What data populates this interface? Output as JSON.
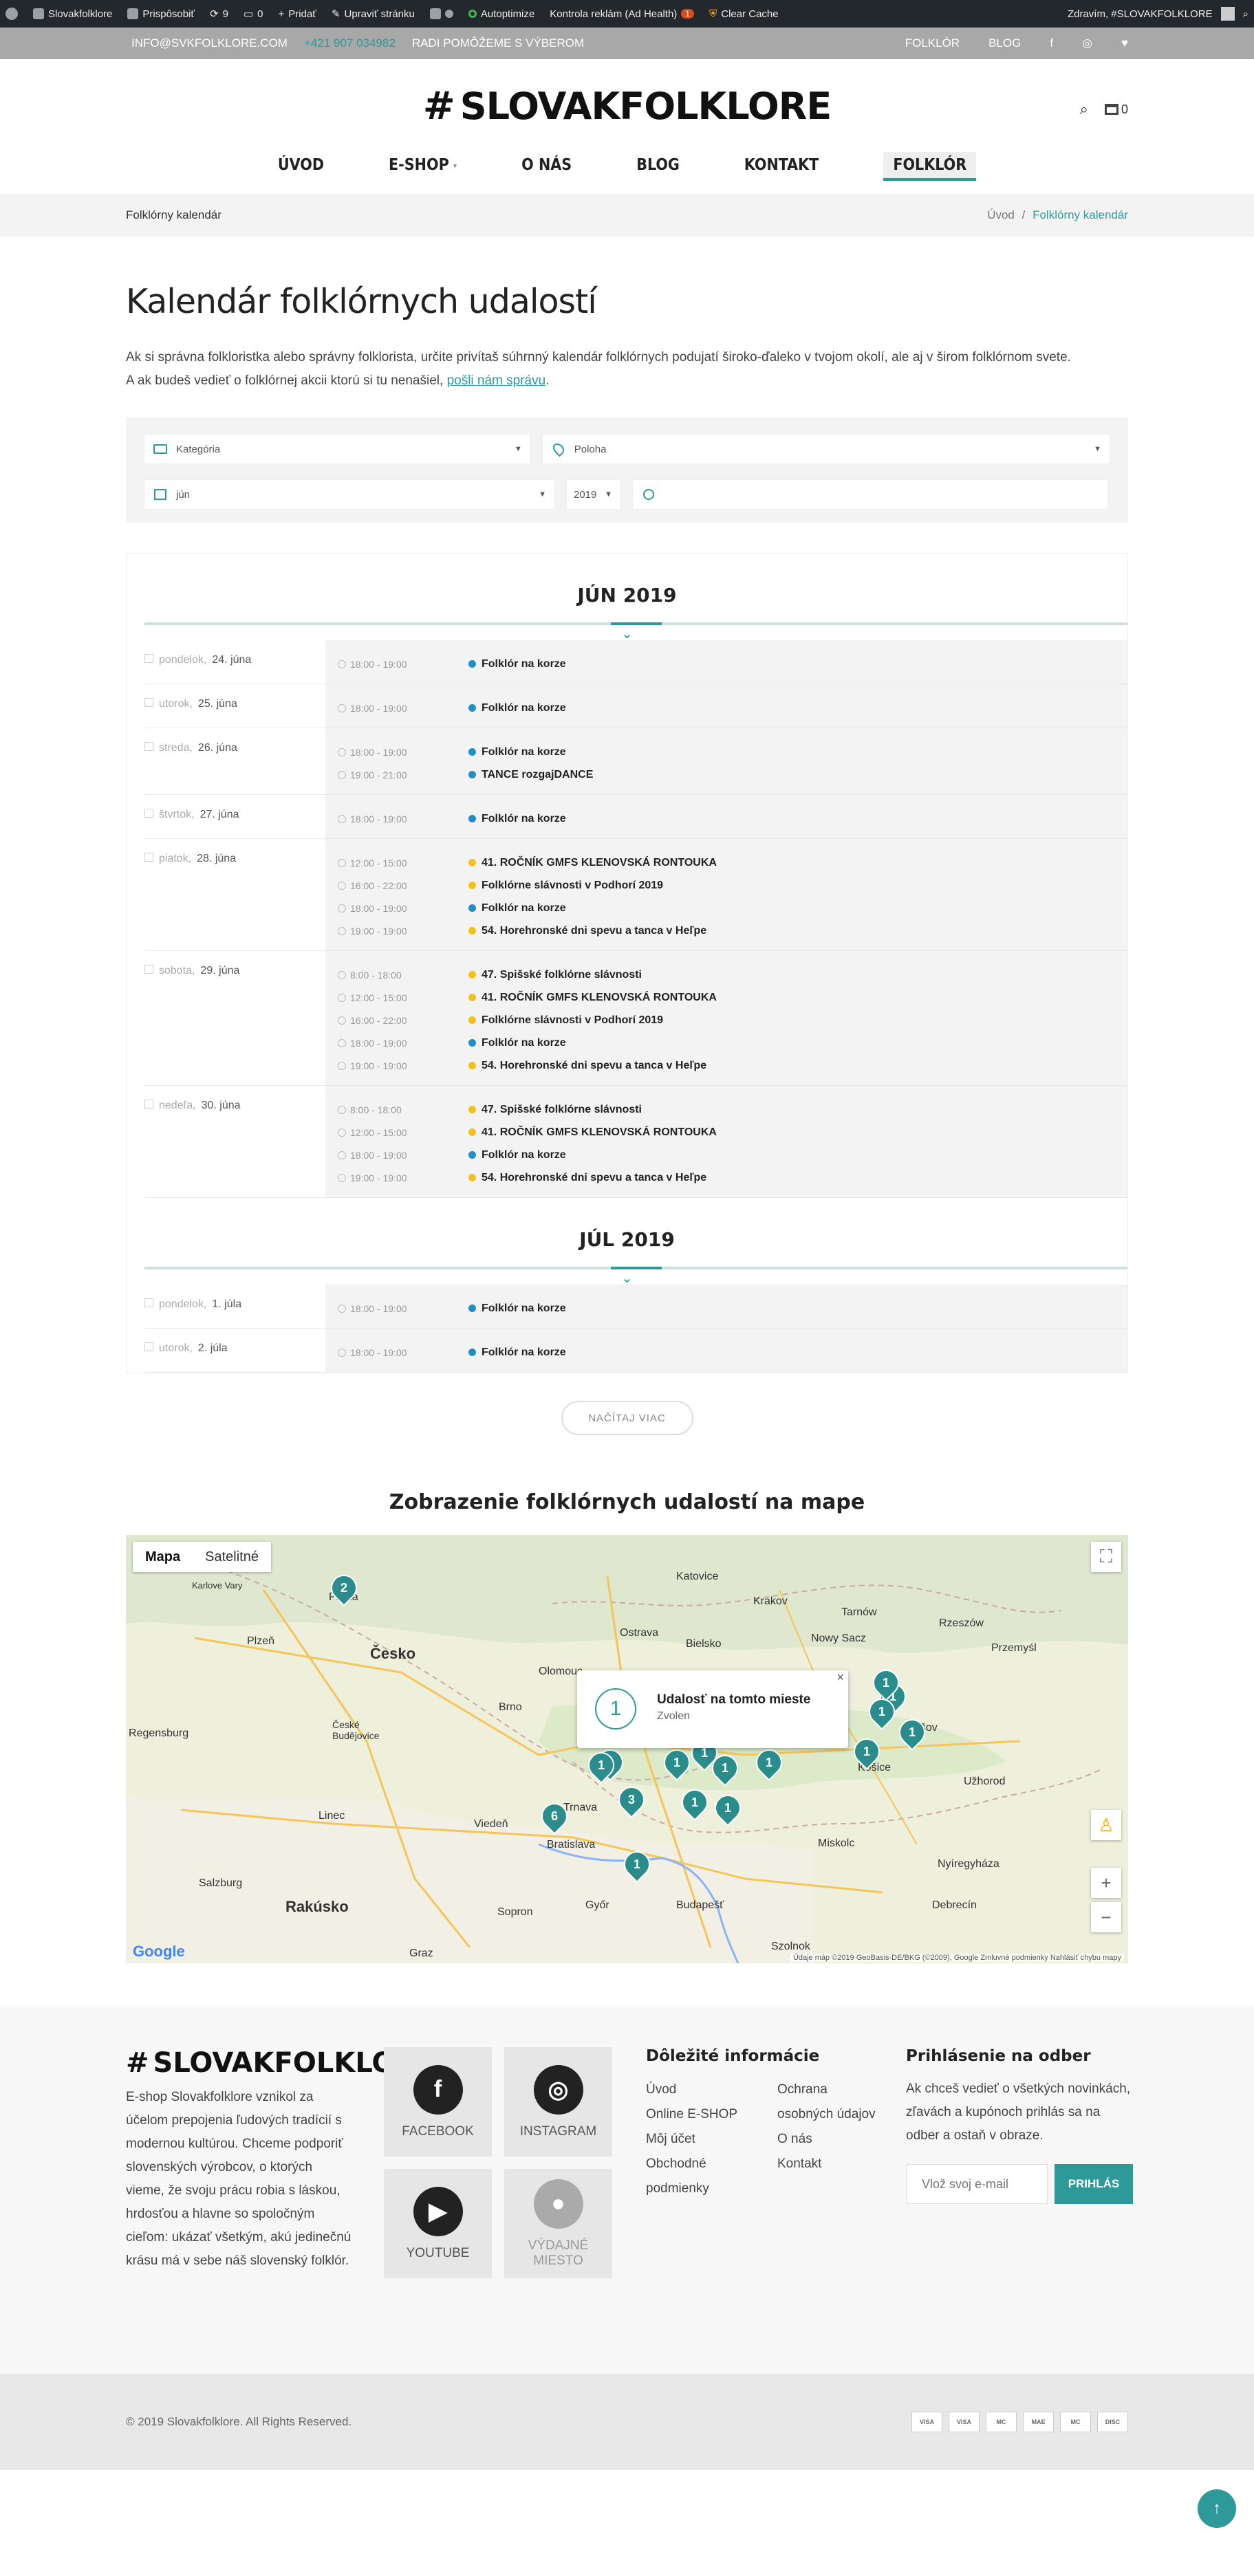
{
  "adminbar": {
    "site": "Slovakfolklore",
    "customize": "Prispôsobiť",
    "updates": "9",
    "comments": "0",
    "add": "Pridať",
    "edit": "Upraviť stránku",
    "autoptimize": "Autoptimize",
    "adhealth": "Kontrola reklám (Ad Health)",
    "adhealth_count": "1",
    "cache": "Clear Cache",
    "greeting": "Zdravím, #SLOVAKFOLKLORE"
  },
  "topbar": {
    "email": "INFO@SVKFOLKLORE.COM",
    "phone": "+421 907 034982",
    "tagline": "RADI POMÔŽEME S VÝBEROM",
    "links": [
      "FOLKLÓR",
      "BLOG"
    ]
  },
  "header": {
    "logo": "SLOVAKFOLKLORE",
    "cart_count": "0"
  },
  "nav": [
    "ÚVOD",
    "E-SHOP",
    "O NÁS",
    "BLOG",
    "KONTAKT",
    "FOLKLÓR"
  ],
  "breadcrumb": {
    "title": "Folklórny kalendár",
    "home": "Úvod",
    "sep": "/",
    "current": "Folklórny kalendár"
  },
  "page": {
    "title": "Kalendár folklórnych udalostí",
    "intro_1": "Ak si správna folkloristka alebo správny folklorista, určite privítaš súhrnný kalendár folklórnych podujatí široko-ďaleko v tvojom okolí, ale aj v širom folklórnom svete.",
    "intro_2": "A ak budeš vedieť o folklórnej akcii ktorú si tu nenašiel,",
    "intro_link": "pošli nám správu",
    "intro_end": "."
  },
  "filters": {
    "category": "Kategória",
    "location": "Poloha",
    "month": "jún",
    "year": "2019",
    "search_placeholder": ""
  },
  "colors": {
    "accent": "#2d9a99",
    "blue": "#1f8fc9",
    "yellow": "#f2c21b"
  },
  "calendar": {
    "months": [
      {
        "title": "JÚN 2019",
        "days": [
          {
            "weekday": "pondelok,",
            "date": "24. júna",
            "events": [
              {
                "time": "18:00 - 19:00",
                "name": "Folklór na korze",
                "color": "blue"
              }
            ]
          },
          {
            "weekday": "utorok,",
            "date": "25. júna",
            "events": [
              {
                "time": "18:00 - 19:00",
                "name": "Folklór na korze",
                "color": "blue"
              }
            ]
          },
          {
            "weekday": "streda,",
            "date": "26. júna",
            "events": [
              {
                "time": "18:00 - 19:00",
                "name": "Folklór na korze",
                "color": "blue"
              },
              {
                "time": "19:00 - 21:00",
                "name": "TANCE rozgajDANCE",
                "color": "blue"
              }
            ]
          },
          {
            "weekday": "štvrtok,",
            "date": "27. júna",
            "events": [
              {
                "time": "18:00 - 19:00",
                "name": "Folklór na korze",
                "color": "blue"
              }
            ]
          },
          {
            "weekday": "piatok,",
            "date": "28. júna",
            "events": [
              {
                "time": "12:00 - 15:00",
                "name": "41. ROČNÍK GMFS KLENOVSKÁ RONTOUKA",
                "color": "yellow"
              },
              {
                "time": "16:00 - 22:00",
                "name": "Folklórne slávnosti v Podhorí 2019",
                "color": "yellow"
              },
              {
                "time": "18:00 - 19:00",
                "name": "Folklór na korze",
                "color": "blue"
              },
              {
                "time": "19:00 - 19:00",
                "name": "54. Horehronské dni spevu a tanca v Heľpe",
                "color": "yellow"
              }
            ]
          },
          {
            "weekday": "sobota,",
            "date": "29. júna",
            "events": [
              {
                "time": "8:00 - 18:00",
                "name": "47. Spišské folklórne slávnosti",
                "color": "yellow"
              },
              {
                "time": "12:00 - 15:00",
                "name": "41. ROČNÍK GMFS KLENOVSKÁ RONTOUKA",
                "color": "yellow"
              },
              {
                "time": "16:00 - 22:00",
                "name": "Folklórne slávnosti v Podhorí 2019",
                "color": "yellow"
              },
              {
                "time": "18:00 - 19:00",
                "name": "Folklór na korze",
                "color": "blue"
              },
              {
                "time": "19:00 - 19:00",
                "name": "54. Horehronské dni spevu a tanca v Heľpe",
                "color": "yellow"
              }
            ]
          },
          {
            "weekday": "nedeľa,",
            "date": "30. júna",
            "events": [
              {
                "time": "8:00 - 18:00",
                "name": "47. Spišské folklórne slávnosti",
                "color": "yellow"
              },
              {
                "time": "12:00 - 15:00",
                "name": "41. ROČNÍK GMFS KLENOVSKÁ RONTOUKA",
                "color": "yellow"
              },
              {
                "time": "18:00 - 19:00",
                "name": "Folklór na korze",
                "color": "blue"
              },
              {
                "time": "19:00 - 19:00",
                "name": "54. Horehronské dni spevu a tanca v Heľpe",
                "color": "yellow"
              }
            ]
          }
        ]
      },
      {
        "title": "JÚL 2019",
        "days": [
          {
            "weekday": "pondelok,",
            "date": "1. júla",
            "events": [
              {
                "time": "18:00 - 19:00",
                "name": "Folklór na korze",
                "color": "blue"
              }
            ]
          },
          {
            "weekday": "utorok,",
            "date": "2. júla",
            "events": [
              {
                "time": "18:00 - 19:00",
                "name": "Folklór na korze",
                "color": "blue"
              }
            ]
          }
        ]
      }
    ],
    "load_more": "NAČÍTAJ VIAC"
  },
  "map": {
    "title": "Zobrazenie folklórnych udalostí na mape",
    "type_map": "Mapa",
    "type_sat": "Satelitné",
    "popup_count": "1",
    "popup_title": "Udalosť na tomto mieste",
    "popup_place": "Zvolen",
    "labels": [
      "Česko",
      "Rakúsko",
      "Katovice",
      "Krakov",
      "Praha",
      "Brno",
      "Ostrava",
      "Bratislava",
      "Viedeň",
      "Budapešť",
      "Košice",
      "Prešov",
      "Trnava",
      "Plzeň",
      "Linec",
      "Győr",
      "Debrecín",
      "Tarnów",
      "Nowy Sacz",
      "Rzeszów",
      "Przemyśl",
      "Užhorod",
      "Salzburg",
      "Regensburg",
      "Olomouc",
      "Bielsko",
      "Miskolc",
      "Nyíregyháza",
      "Sopron",
      "Szolnok",
      "Graz",
      "Karlove Vary",
      "České Budějovice"
    ],
    "markers": [
      "2",
      "1",
      "1",
      "1",
      "1",
      "1",
      "1",
      "1",
      "1",
      "1",
      "6",
      "3",
      "1",
      "1",
      "1",
      "1",
      "1",
      "1"
    ],
    "brand": "Google",
    "attribution": "Údaje máp ©2019 GeoBasis-DE/BKG (©2009), Google   Zmluvné podmienky   Nahlásiť chybu mapy"
  },
  "footer": {
    "logo": "SLOVAKFOLKLORE",
    "about": "E-shop Slovakfolklore vznikol za účelom prepojenia ľudových tradícií s modernou kultúrou. Chceme podporiť slovenských výrobcov, o ktorých vieme, že svoju prácu robia s láskou, hrdosťou a hlavne so spoločným cieľom: ukázať všetkým, akú jedinečnú krásu má v sebe náš slovenský folklór.",
    "social": [
      {
        "label": "FACEBOOK",
        "glyph": "f"
      },
      {
        "label": "INSTAGRAM",
        "glyph": "◎"
      },
      {
        "label": "YOUTUBE",
        "glyph": "▶"
      },
      {
        "label": "VÝDAJNÉ MIESTO",
        "glyph": "●"
      }
    ],
    "info_title": "Dôležité informácie",
    "info_col1": [
      "Úvod",
      "Online E-SHOP",
      "Môj účet",
      "Obchodné podmienky"
    ],
    "info_col2": [
      "Ochrana osobných údajov",
      "O nás",
      "Kontakt"
    ],
    "news_title": "Prihlásenie na odber",
    "news_text": "Ak chceš vedieť o všetkých novinkách, zľavách a kupónoch prihlás sa na odber a ostaň v obraze.",
    "news_placeholder": "Vlož svoj e-mail",
    "news_button": "PRIHLÁS",
    "copyright": "© 2019 Slovakfolklore. All Rights Reserved.",
    "cards": [
      "VISA",
      "VISA",
      "MC",
      "MAE",
      "MC",
      "DISC"
    ]
  }
}
